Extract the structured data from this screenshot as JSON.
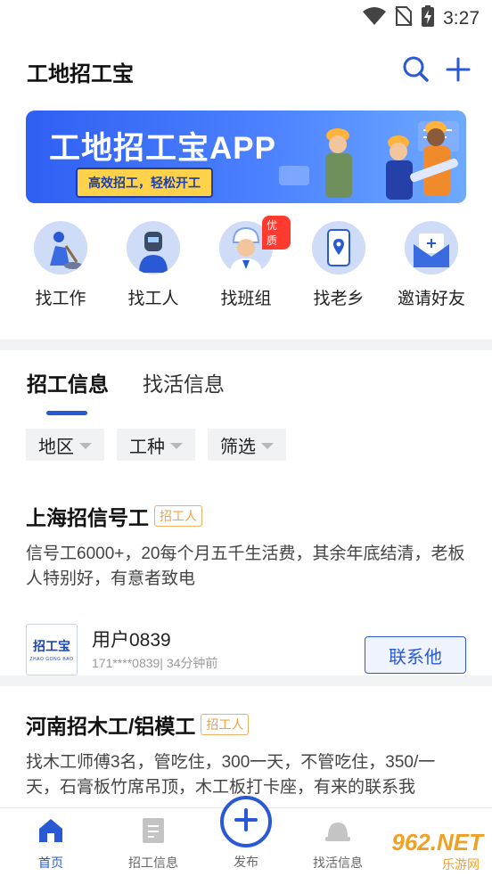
{
  "status_bar": {
    "time": "3:27"
  },
  "header": {
    "title": "工地招工宝"
  },
  "banner": {
    "title": "工地招工宝APP",
    "tagline": "高效招工，轻松开工"
  },
  "quick_entries": [
    {
      "label": "找工作",
      "icon": "worker-digging-icon"
    },
    {
      "label": "找工人",
      "icon": "welder-icon"
    },
    {
      "label": "找班组",
      "icon": "engineer-helmet-icon",
      "badge": "优质"
    },
    {
      "label": "找老乡",
      "icon": "phone-location-icon"
    },
    {
      "label": "邀请好友",
      "icon": "envelope-invite-icon"
    }
  ],
  "tabs": [
    {
      "label": "招工信息",
      "active": true
    },
    {
      "label": "找活信息",
      "active": false
    }
  ],
  "filters": [
    {
      "label": "地区"
    },
    {
      "label": "工种"
    },
    {
      "label": "筛选"
    }
  ],
  "jobs": [
    {
      "title": "上海招信号工",
      "tag": "招工人",
      "description": "信号工6000+，20每个月五千生活费，其余年底结清，老板人特别好，有意者致电",
      "poster": {
        "logo_text": "招工宝",
        "logo_sub": "ZHAO GONG BAO",
        "name": "用户0839",
        "meta": "171****0839| 34分钟前"
      },
      "contact_label": "联系他"
    },
    {
      "title": "河南招木工/铝模工",
      "tag": "招工人",
      "description": "找木工师傅3名，管吃住，300一天，不管吃住，350/一天，石膏板竹席吊顶，木工板打卡座，有来的联系我"
    }
  ],
  "bottom_nav": {
    "items": [
      {
        "label": "首页",
        "icon": "home-icon",
        "active": true
      },
      {
        "label": "招工信息",
        "icon": "document-icon",
        "active": false
      },
      {
        "label": "发布",
        "icon": "plus-circle-icon",
        "active": false
      },
      {
        "label": "找活信息",
        "icon": "hard-hat-icon",
        "active": false
      }
    ]
  },
  "watermark": {
    "text": "962.NET",
    "sub": "乐游网"
  },
  "colors": {
    "accent": "#2a59d6",
    "tag": "#f0a040",
    "badge": "#ff3b30"
  }
}
